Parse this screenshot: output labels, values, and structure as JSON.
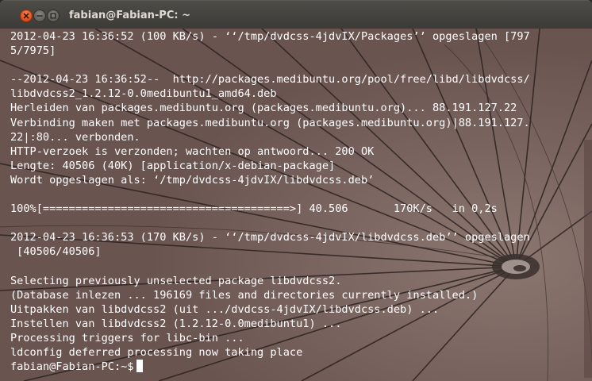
{
  "window": {
    "title": "fabian@Fabian-PC: ~",
    "controls": {
      "close_icon": "close-icon",
      "minimize_icon": "minimize-icon",
      "maximize_icon": "maximize-icon"
    }
  },
  "terminal": {
    "lines": [
      "2012-04-23 16:36:52 (100 KB/s) - ‘‘/tmp/dvdcss-4jdvIX/Packages’’ opgeslagen [797",
      "5/7975]",
      "",
      "--2012-04-23 16:36:52--  http://packages.medibuntu.org/pool/free/libd/libdvdcss/",
      "libdvdcss2_1.2.12-0.0medibuntu1_amd64.deb",
      "Herleiden van packages.medibuntu.org (packages.medibuntu.org)... 88.191.127.22",
      "Verbinding maken met packages.medibuntu.org (packages.medibuntu.org)|88.191.127.",
      "22|:80... verbonden.",
      "HTTP-verzoek is verzonden; wachten op antwoord... 200 OK",
      "Lengte: 40506 (40K) [application/x-debian-package]",
      "Wordt opgeslagen als: ‘/tmp/dvdcss-4jdvIX/libdvdcss.deb’",
      "",
      "100%[======================================>] 40.506       170K/s   in 0,2s",
      "",
      "2012-04-23 16:36:53 (170 KB/s) - ‘‘/tmp/dvdcss-4jdvIX/libdvdcss.deb’’ opgeslagen",
      " [40506/40506]",
      "",
      "Selecting previously unselected package libdvdcss2.",
      "(Database inlezen ... 196169 files and directories currently installed.)",
      "Uitpakken van libdvdcss2 (uit .../dvdcss-4jdvIX/libdvdcss.deb) ...",
      "Instellen van libdvdcss2 (1.2.12-0.0medibuntu1) ...",
      "Processing triggers for libc-bin ...",
      "ldconfig deferred processing now taking place"
    ],
    "prompt": "fabian@Fabian-PC:~$",
    "background_color": "#735d58",
    "text_color": "#ffffff"
  }
}
